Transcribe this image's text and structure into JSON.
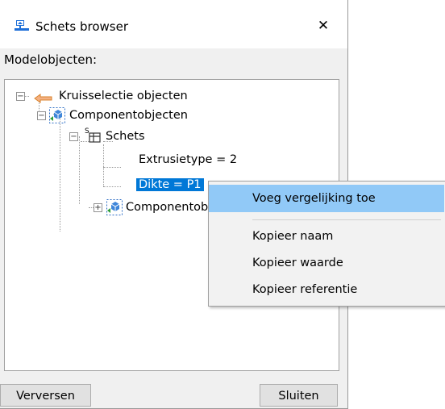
{
  "window": {
    "title": "Schets browser",
    "close_glyph": "✕",
    "icon": "sketch-app-icon"
  },
  "section_label": "Modelobjecten:",
  "tree": {
    "items": [
      {
        "label": "Kruisselectie objecten",
        "icon": "selection-arrow-icon",
        "expander": "−"
      },
      {
        "label": "Componentobjecten",
        "icon": "component-icon",
        "expander": "−"
      },
      {
        "label": "Schets",
        "icon": "sketch-tree-icon",
        "expander": "−",
        "superscript": "S"
      },
      {
        "label": "Extrusietype = 2"
      },
      {
        "label": "Dikte = P1",
        "selected": true
      },
      {
        "label": "Componentobjecten",
        "icon": "component-icon",
        "expander": "+"
      }
    ]
  },
  "buttons": {
    "refresh": "Verversen",
    "close": "Sluiten"
  },
  "context_menu": {
    "items": [
      {
        "label": "Voeg vergelijking toe",
        "highlighted": true
      },
      {
        "label": "Kopieer naam"
      },
      {
        "label": "Kopieer waarde"
      },
      {
        "label": "Kopieer referentie"
      }
    ]
  },
  "colors": {
    "selection": "#0078d7",
    "menu_highlight": "#91c9f7",
    "dialog_bg": "#f0f0f0"
  }
}
